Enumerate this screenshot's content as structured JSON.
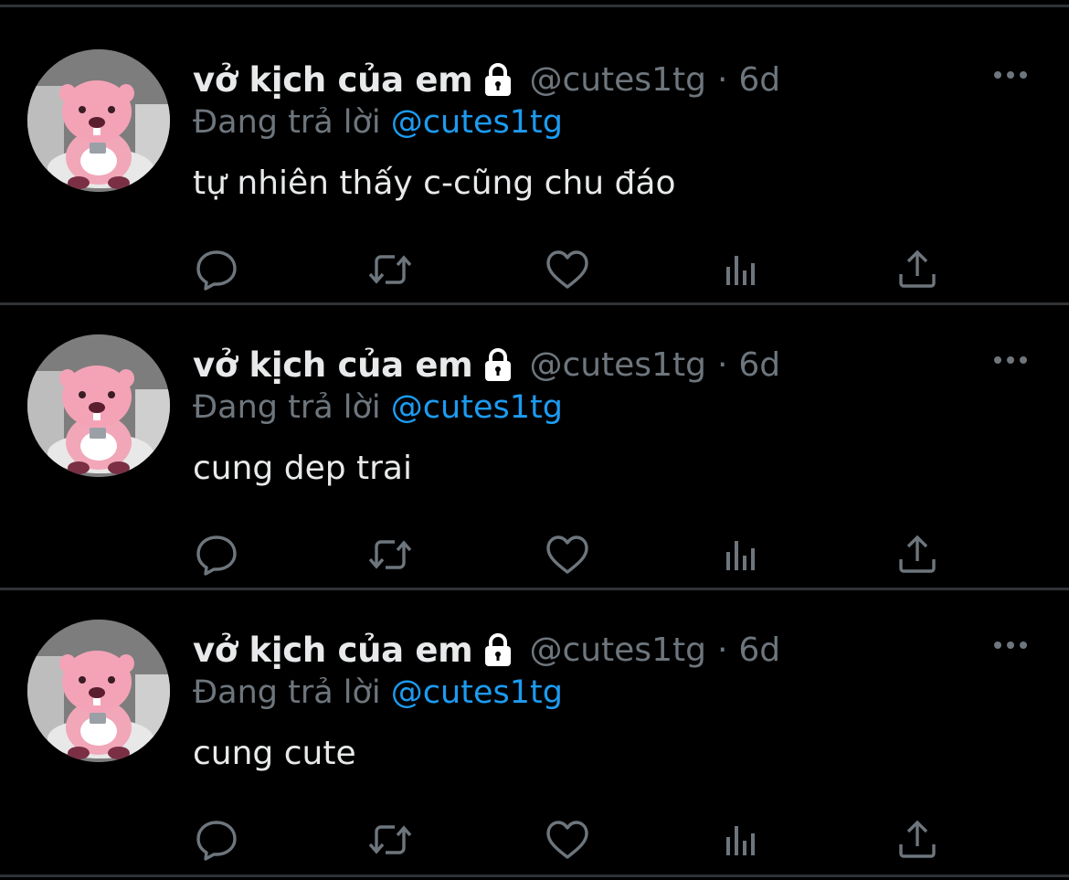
{
  "tweets": [
    {
      "display_name": "vở kịch của em",
      "handle": "@cutes1tg",
      "separator": "·",
      "time": "6d",
      "replying_prefix": "Đang trả lời",
      "replying_to": "@cutes1tg",
      "text": "tự nhiên thấy c-cũng chu đáo"
    },
    {
      "display_name": "vở kịch của em",
      "handle": "@cutes1tg",
      "separator": "·",
      "time": "6d",
      "replying_prefix": "Đang trả lời",
      "replying_to": "@cutes1tg",
      "text": "cung dep trai"
    },
    {
      "display_name": "vở kịch của em",
      "handle": "@cutes1tg",
      "separator": "·",
      "time": "6d",
      "replying_prefix": "Đang trả lời",
      "replying_to": "@cutes1tg",
      "text": "cung cute"
    }
  ],
  "icons": {
    "lock": "lock-icon",
    "more": "more-horizontal-icon",
    "reply": "reply-icon",
    "retweet": "retweet-icon",
    "like": "heart-icon",
    "analytics": "analytics-icon",
    "share": "share-icon"
  },
  "colors": {
    "background": "#000000",
    "text": "#e7e9ea",
    "muted": "#6e767d",
    "link": "#1d9bf0",
    "separator": "#2f3336"
  }
}
